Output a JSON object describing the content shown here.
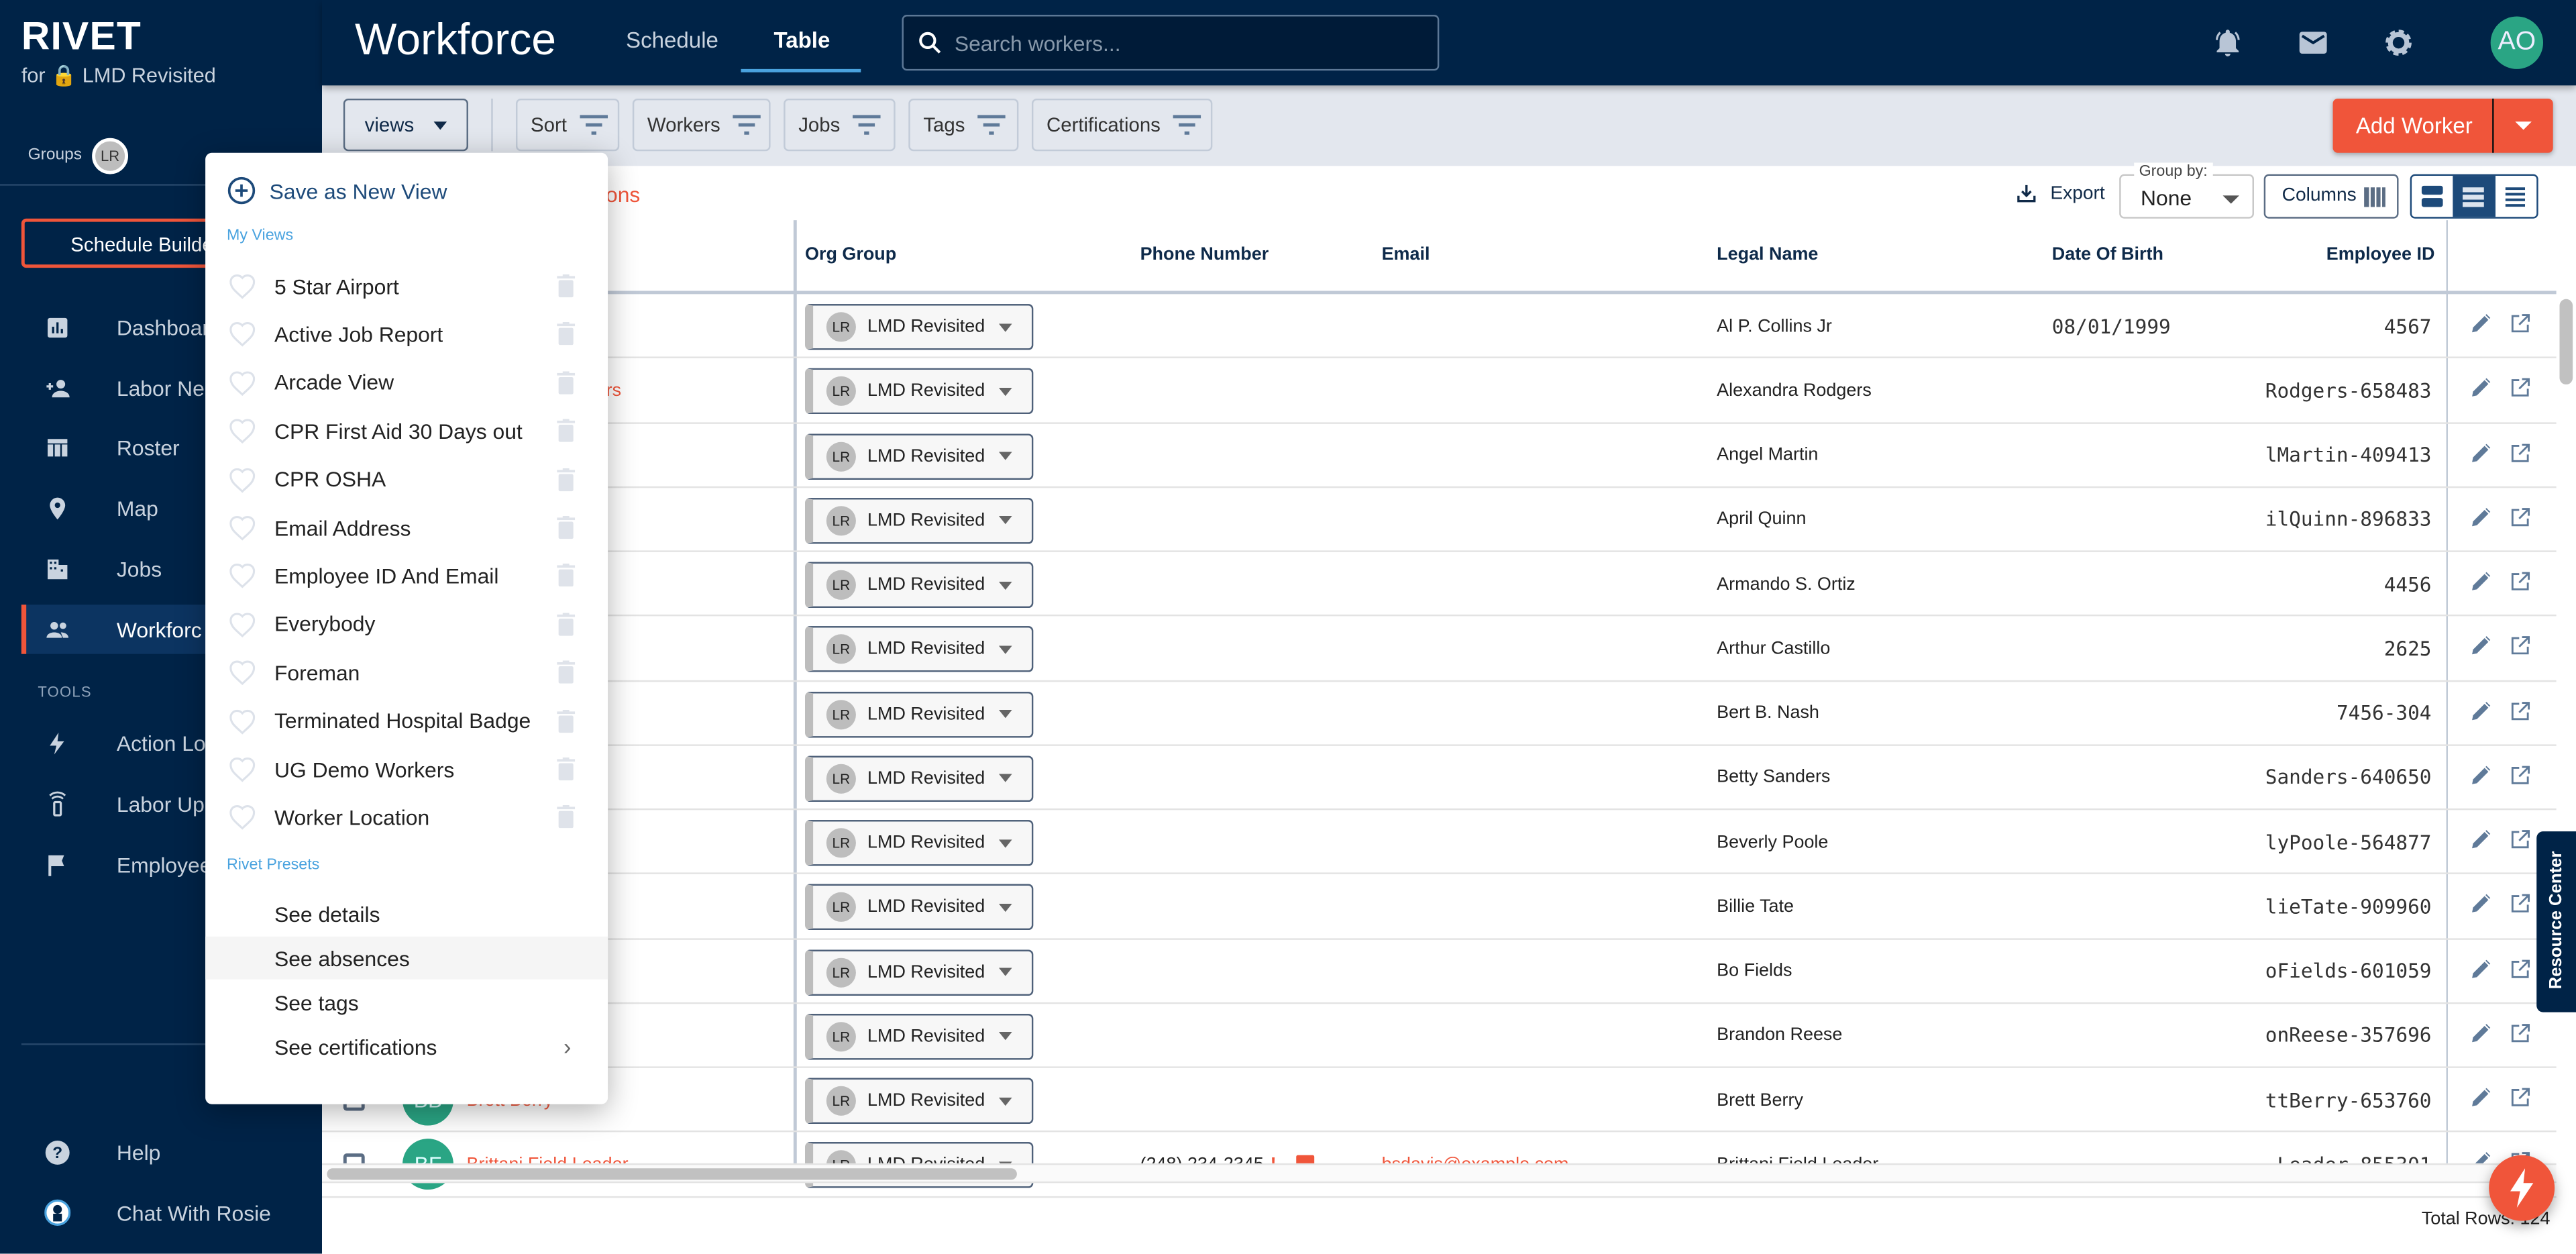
{
  "brand": {
    "logo": "RIVET",
    "org_prefix": "for",
    "org_name": "LMD Revisited"
  },
  "sidebar": {
    "groups_label": "Groups",
    "groups_avatar": "LR",
    "schedule_builder": "Schedule Builder",
    "items": [
      {
        "label": "Dashboar",
        "icon": "bar-chart-icon"
      },
      {
        "label": "Labor Ne",
        "icon": "person-add-icon"
      },
      {
        "label": "Roster",
        "icon": "table-icon"
      },
      {
        "label": "Map",
        "icon": "map-pin-icon"
      },
      {
        "label": "Jobs",
        "icon": "building-icon"
      },
      {
        "label": "Workforc",
        "icon": "people-icon",
        "active": true
      }
    ],
    "tools_label": "TOOLS",
    "tools": [
      {
        "label": "Action Lo",
        "icon": "lightning-icon"
      },
      {
        "label": "Labor Up",
        "icon": "phone-signal-icon"
      },
      {
        "label": "Employee",
        "icon": "flag-icon"
      }
    ],
    "help": "Help",
    "chat": "Chat With Rosie"
  },
  "header": {
    "title": "Workforce",
    "tabs": [
      {
        "label": "Schedule"
      },
      {
        "label": "Table",
        "selected": true
      }
    ],
    "search_placeholder": "Search workers...",
    "user_initials": "AO"
  },
  "toolbar": {
    "views": "views",
    "filters": [
      "Sort",
      "Workers",
      "Jobs",
      "Tags",
      "Certifications"
    ],
    "add_worker": "Add Worker"
  },
  "subbar": {
    "link_fragment": "ations",
    "export": "Export",
    "group_by_label": "Group by:",
    "group_by_value": "None",
    "columns": "Columns"
  },
  "table": {
    "headers": {
      "org_group": "Org Group",
      "phone": "Phone Number",
      "email": "Email",
      "legal_name": "Legal Name",
      "dob": "Date Of Birth",
      "employee_id": "Employee ID"
    },
    "rows": [
      {
        "org": "LMD Revisited",
        "org_initials": "LR",
        "legal": "Al P. Collins Jr",
        "dob": "08/01/1999",
        "emp": "4567"
      },
      {
        "name": "Alexandra Rodgers",
        "org": "LMD Revisited",
        "org_initials": "LR",
        "legal": "Alexandra Rodgers",
        "emp": "Rodgers-658483"
      },
      {
        "org": "LMD Revisited",
        "org_initials": "LR",
        "legal": "Angel Martin",
        "emp": "lMartin-409413"
      },
      {
        "org": "LMD Revisited",
        "org_initials": "LR",
        "legal": "April Quinn",
        "emp": "ilQuinn-896833"
      },
      {
        "org": "LMD Revisited",
        "org_initials": "LR",
        "legal": "Armando S. Ortiz",
        "emp": "4456"
      },
      {
        "org": "LMD Revisited",
        "org_initials": "LR",
        "legal": "Arthur Castillo",
        "emp": "2625"
      },
      {
        "org": "LMD Revisited",
        "org_initials": "LR",
        "legal": "Bert B. Nash",
        "emp": "7456-304"
      },
      {
        "org": "LMD Revisited",
        "org_initials": "LR",
        "legal": "Betty Sanders",
        "emp": "Sanders-640650"
      },
      {
        "org": "LMD Revisited",
        "org_initials": "LR",
        "legal": "Beverly Poole",
        "emp": "lyPoole-564877"
      },
      {
        "org": "LMD Revisited",
        "org_initials": "LR",
        "legal": "Billie Tate",
        "emp": "lieTate-909960"
      },
      {
        "org": "LMD Revisited",
        "org_initials": "LR",
        "legal": "Bo Fields",
        "emp": "oFields-601059"
      },
      {
        "org": "LMD Revisited",
        "org_initials": "LR",
        "legal": "Brandon Reese",
        "emp": "onReese-357696"
      },
      {
        "name": "Brett Berry",
        "initials": "BB",
        "org": "LMD Revisited",
        "org_initials": "LR",
        "legal": "Brett Berry",
        "emp": "ttBerry-653760"
      },
      {
        "name": "Brittani Field Leader",
        "initials": "BF",
        "org": "LMD Revisited",
        "org_initials": "LR",
        "phone": "(248) 234-2345",
        "email": "bsdavis@example.com",
        "legal": "Brittani Field Leader",
        "emp": "Leader-855301"
      }
    ],
    "total": "Total Rows: 124"
  },
  "views_menu": {
    "save_new": "Save as New View",
    "my_views_label": "My Views",
    "my_views": [
      "5 Star Airport",
      "Active Job Report",
      "Arcade View",
      "CPR First Aid 30 Days out",
      "CPR OSHA",
      "Email Address",
      "Employee ID And Email",
      "Everybody",
      "Foreman",
      "Terminated Hospital Badge",
      "UG Demo Workers",
      "Worker Location"
    ],
    "presets_label": "Rivet Presets",
    "presets": [
      {
        "label": "See details"
      },
      {
        "label": "See absences",
        "hovered": true
      },
      {
        "label": "See tags"
      },
      {
        "label": "See certifications",
        "submenu": true
      }
    ]
  },
  "resource_center": "Resource Center",
  "colors": {
    "navy": "#002347",
    "accent": "#f0553a",
    "green": "#2aa584",
    "link_blue": "#4aa3df"
  }
}
